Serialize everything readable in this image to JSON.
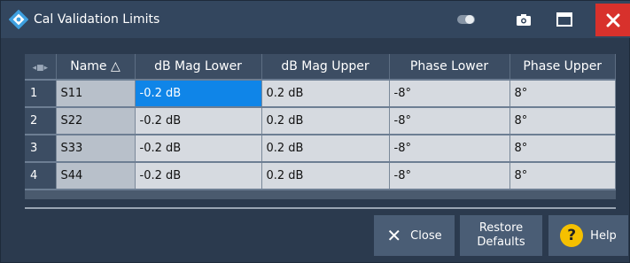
{
  "window": {
    "title": "Cal Validation Limits",
    "close_glyph": "✕"
  },
  "table": {
    "corner_label": "◂■▸",
    "columns": [
      "Name  △",
      "dB Mag Lower",
      "dB Mag Upper",
      "Phase Lower",
      "Phase Upper"
    ],
    "rows": [
      {
        "num": "1",
        "name": "S11",
        "mag_lower": "-0.2 dB",
        "mag_upper": "0.2 dB",
        "phase_lower": "-8°",
        "phase_upper": "8°"
      },
      {
        "num": "2",
        "name": "S22",
        "mag_lower": "-0.2 dB",
        "mag_upper": "0.2 dB",
        "phase_lower": "-8°",
        "phase_upper": "8°"
      },
      {
        "num": "3",
        "name": "S33",
        "mag_lower": "-0.2 dB",
        "mag_upper": "0.2 dB",
        "phase_lower": "-8°",
        "phase_upper": "8°"
      },
      {
        "num": "4",
        "name": "S44",
        "mag_lower": "-0.2 dB",
        "mag_upper": "0.2 dB",
        "phase_lower": "-8°",
        "phase_upper": "8°"
      }
    ],
    "selected_cell": "row 1, dB Mag Lower"
  },
  "buttons": {
    "close_label": "Close",
    "close_icon_glyph": "✕",
    "restore_line1": "Restore",
    "restore_line2": "Defaults",
    "help_label": "Help",
    "help_icon_glyph": "?"
  },
  "colors": {
    "title_bar": "#33465e",
    "background": "#2b3a4e",
    "selected_cell": "#0f85e8",
    "close_button": "#d8312c",
    "help_icon": "#f5c000"
  },
  "icons": [
    "app-logo-icon",
    "toggle-icon",
    "camera-icon",
    "maximize-icon",
    "close-icon",
    "help-icon"
  ]
}
